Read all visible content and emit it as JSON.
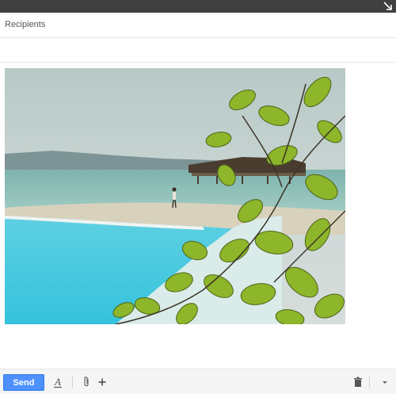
{
  "titlebar": {
    "expand_icon": "diagonal-arrow-icon"
  },
  "compose": {
    "recipients_label": "Recipients",
    "subject_placeholder": "",
    "body_image": "beach-resort-photo"
  },
  "toolbar": {
    "send_label": "Send",
    "formatting_icon": "text-format-icon",
    "attach_icon": "paperclip-icon",
    "more_icon": "plus-icon",
    "trash_icon": "trash-icon",
    "options_icon": "chevron-down-icon"
  },
  "colors": {
    "titlebar": "#404040",
    "send_button": "#4d90fe",
    "pool": "#40c8e0",
    "sea": "#8fc4bc",
    "sky": "#c9d6d6",
    "leaves": "#8db62a"
  }
}
